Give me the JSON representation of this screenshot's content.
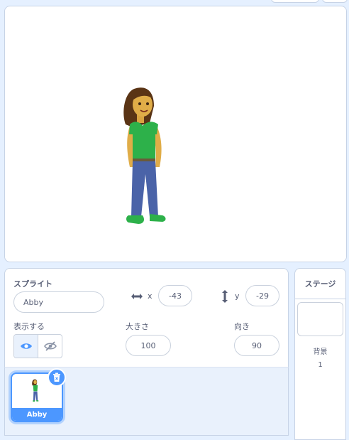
{
  "sprite_info": {
    "heading": "スプライト",
    "name_value": "Abby",
    "x_label": "x",
    "x_value": "-43",
    "y_label": "y",
    "y_value": "-29",
    "show_label": "表示する",
    "size_label": "大きさ",
    "size_value": "100",
    "direction_label": "向き",
    "direction_value": "90"
  },
  "sprites": [
    {
      "name": "Abby",
      "selected": true
    }
  ],
  "stage_panel": {
    "heading": "ステージ",
    "backdrops_label": "背景",
    "backdrops_count": "1"
  },
  "icons": {
    "x_axis": "horizontal-arrows-icon",
    "y_axis": "vertical-arrows-icon",
    "show": "eye-icon",
    "hide": "eye-slash-icon",
    "delete": "trash-icon"
  },
  "colors": {
    "accent": "#4c97ff",
    "text": "#575e75",
    "background": "#e5f0ff"
  }
}
